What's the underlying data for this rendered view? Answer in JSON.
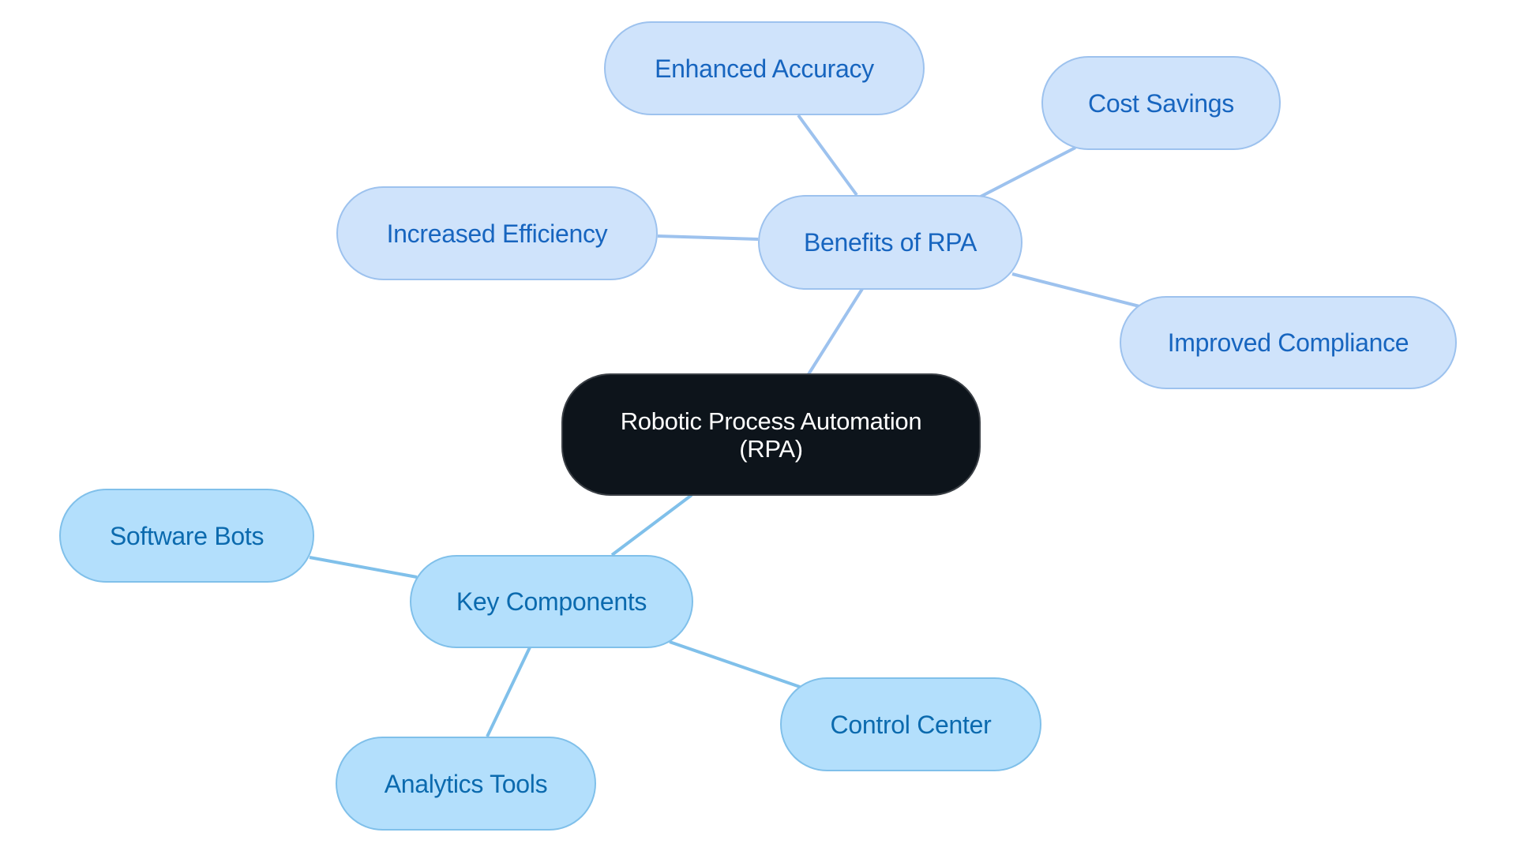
{
  "diagram": {
    "type": "mind-map",
    "root": {
      "id": "root",
      "label": "Robotic Process Automation\n(RPA)"
    },
    "branches": [
      {
        "id": "benefits",
        "label": "Benefits of RPA",
        "colors": {
          "fill": "#cfe3fb",
          "stroke": "#9dc2ee",
          "text": "#1765bf",
          "edge": "#9dc2ee"
        },
        "children": [
          {
            "id": "enhanced-accuracy",
            "label": "Enhanced Accuracy"
          },
          {
            "id": "cost-savings",
            "label": "Cost Savings"
          },
          {
            "id": "increased-efficiency",
            "label": "Increased Efficiency"
          },
          {
            "id": "improved-compliance",
            "label": "Improved Compliance"
          }
        ]
      },
      {
        "id": "components",
        "label": "Key Components",
        "colors": {
          "fill": "#b3dffc",
          "stroke": "#80c0ea",
          "text": "#0b6aae",
          "edge": "#80c0ea"
        },
        "children": [
          {
            "id": "software-bots",
            "label": "Software Bots"
          },
          {
            "id": "control-center",
            "label": "Control Center"
          },
          {
            "id": "analytics-tools",
            "label": "Analytics Tools"
          }
        ]
      }
    ],
    "root_colors": {
      "fill": "#0d141b",
      "stroke": "#3a3f45",
      "text": "#ffffff"
    }
  }
}
